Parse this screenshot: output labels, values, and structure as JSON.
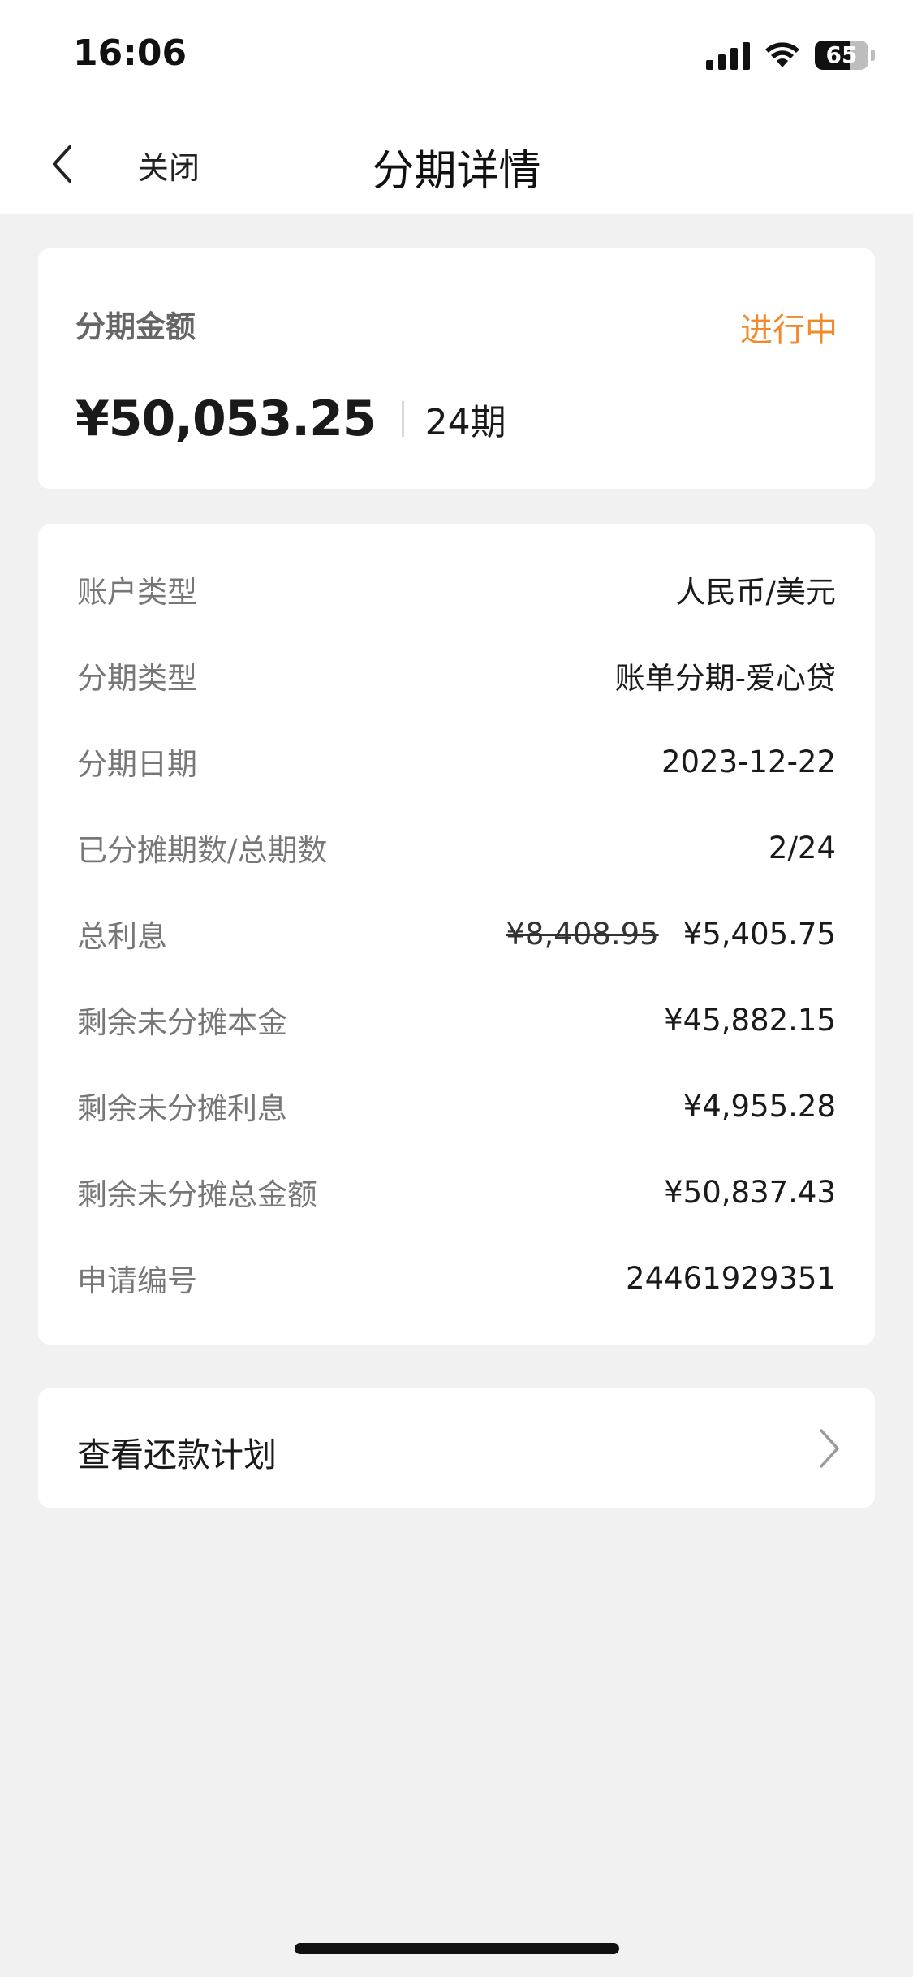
{
  "status_bar": {
    "time": "16:06",
    "battery": "65"
  },
  "nav": {
    "close_label": "关闭",
    "title": "分期详情"
  },
  "summary": {
    "label": "分期金额",
    "status": "进行中",
    "amount": "¥50,053.25",
    "periods": "24期"
  },
  "details": [
    {
      "label": "账户类型",
      "value": "人民币/美元"
    },
    {
      "label": "分期类型",
      "value": "账单分期-爱心贷"
    },
    {
      "label": "分期日期",
      "value": "2023-12-22"
    },
    {
      "label": "已分摊期数/总期数",
      "value": "2/24"
    },
    {
      "label": "总利息",
      "original": "¥8,408.95",
      "value": "¥5,405.75"
    },
    {
      "label": "剩余未分摊本金",
      "value": "¥45,882.15"
    },
    {
      "label": "剩余未分摊利息",
      "value": "¥4,955.28"
    },
    {
      "label": "剩余未分摊总金额",
      "value": "¥50,837.43"
    },
    {
      "label": "申请编号",
      "value": "24461929351"
    }
  ],
  "plan": {
    "label": "查看还款计划"
  },
  "colors": {
    "accent": "#f08a2a",
    "background": "#f1f1f1"
  }
}
